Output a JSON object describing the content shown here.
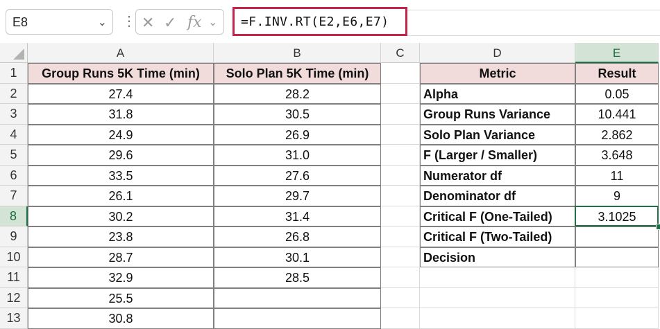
{
  "formula_bar": {
    "name_box": "E8",
    "formula": "=F.INV.RT(E2,E6,E7)"
  },
  "columns": [
    "A",
    "B",
    "C",
    "D",
    "E"
  ],
  "rows": [
    "1",
    "2",
    "3",
    "4",
    "5",
    "6",
    "7",
    "8",
    "9",
    "10",
    "11",
    "12",
    "13"
  ],
  "table_left": {
    "headers": [
      "Group Runs 5K Time (min)",
      "Solo Plan 5K Time (min)"
    ],
    "group_runs": [
      "27.4",
      "31.8",
      "24.9",
      "29.6",
      "33.5",
      "26.1",
      "30.2",
      "23.8",
      "28.7",
      "32.9",
      "25.5",
      "30.8"
    ],
    "solo_plan": [
      "28.2",
      "30.5",
      "26.9",
      "31.0",
      "27.6",
      "29.7",
      "31.4",
      "26.8",
      "30.1",
      "28.5",
      "",
      ""
    ]
  },
  "table_right": {
    "headers": [
      "Metric",
      "Result"
    ],
    "rows": [
      {
        "metric": "Alpha",
        "result": "0.05"
      },
      {
        "metric": "Group Runs Variance",
        "result": "10.441"
      },
      {
        "metric": "Solo Plan Variance",
        "result": "2.862"
      },
      {
        "metric": "F (Larger / Smaller)",
        "result": "3.648"
      },
      {
        "metric": "Numerator df",
        "result": "11"
      },
      {
        "metric": "Denominator df",
        "result": "9"
      },
      {
        "metric": "Critical F (One-Tailed)",
        "result": "3.1025"
      },
      {
        "metric": "Critical F (Two-Tailed)",
        "result": ""
      },
      {
        "metric": "Decision",
        "result": ""
      }
    ]
  },
  "colors": {
    "header_fill": "#f2dcdb",
    "selection": "#1e7145",
    "formula_highlight": "#c4244a"
  }
}
